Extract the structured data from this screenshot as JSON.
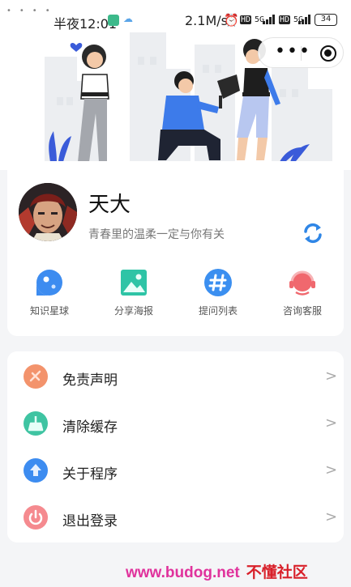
{
  "status": {
    "time": "半夜12:01",
    "speed": "2.1M/s",
    "hd1": "HD",
    "net1": "5G",
    "hd2": "HD",
    "net2": "5G",
    "battery": "34"
  },
  "capsule": {
    "more_glyph": "•••"
  },
  "profile": {
    "name": "天大",
    "signature": "青春里的温柔一定与你有关"
  },
  "grid": [
    {
      "label": "知识星球",
      "icon": "planet-icon",
      "color": "#3d8cf0"
    },
    {
      "label": "分享海报",
      "icon": "image-icon",
      "color": "#2ec4a6"
    },
    {
      "label": "提问列表",
      "icon": "hashtag-icon",
      "color": "#3b8ff0"
    },
    {
      "label": "咨询客服",
      "icon": "headset-icon",
      "color": "#f0686e"
    }
  ],
  "menu": [
    {
      "label": "免责声明",
      "icon": "disclaimer-icon",
      "color": "#f3936c"
    },
    {
      "label": "清除缓存",
      "icon": "broom-icon",
      "color": "#3fc4a2"
    },
    {
      "label": "关于程序",
      "icon": "upload-icon",
      "color": "#3d8cf0"
    },
    {
      "label": "退出登录",
      "icon": "power-icon",
      "color": "#f58a8f"
    }
  ],
  "watermark": {
    "url": "www.budog.net",
    "name": "不懂社区"
  }
}
